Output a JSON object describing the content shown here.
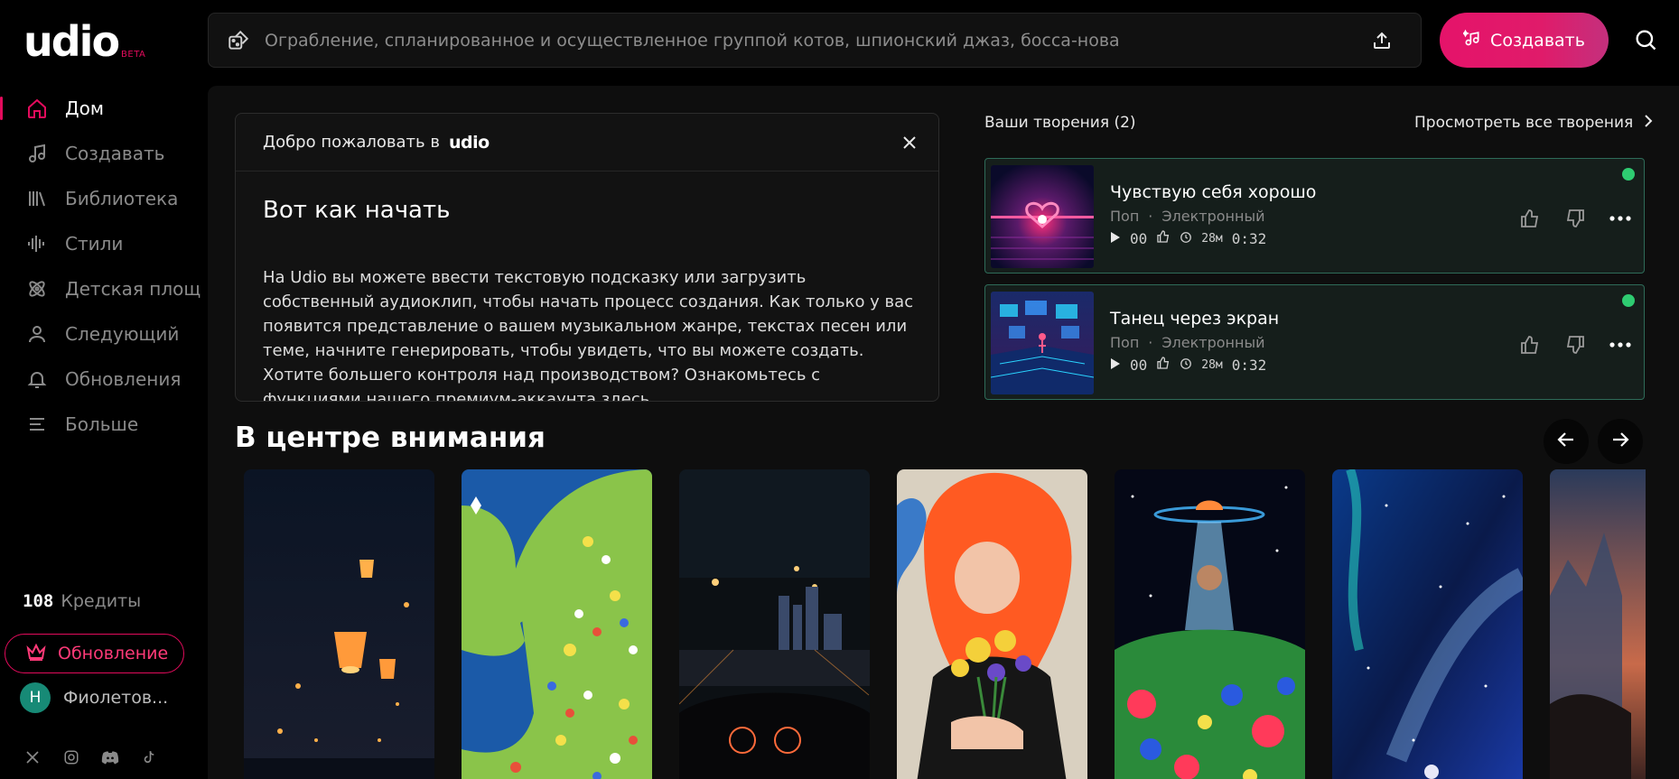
{
  "brand": {
    "logo": "udio",
    "beta": "BETA"
  },
  "nav": {
    "items": [
      {
        "label": "Дом",
        "icon": "home-icon",
        "active": true
      },
      {
        "label": "Создавать",
        "icon": "music-note-icon"
      },
      {
        "label": "Библиотека",
        "icon": "library-icon"
      },
      {
        "label": "Стили",
        "icon": "waveform-icon"
      },
      {
        "label": "Детская площ",
        "icon": "atom-icon"
      },
      {
        "label": "Следующий",
        "icon": "user-icon"
      },
      {
        "label": "Обновления",
        "icon": "bell-icon"
      },
      {
        "label": "Больше",
        "icon": "menu-icon"
      }
    ]
  },
  "credits": {
    "count": "108",
    "label": "Кредиты"
  },
  "upgrade": {
    "label": "Обновление"
  },
  "user": {
    "initial": "Н",
    "name": "Фиолетов..."
  },
  "search": {
    "placeholder": "Ограбление, спланированное и осуществленное группой котов, шпионский джаз, босса-нова"
  },
  "create_button": {
    "label": "Создавать"
  },
  "welcome": {
    "heading_prefix": "Добро пожаловать в",
    "brand": "udio",
    "title": "Вот как начать",
    "body": "На Udio вы можете ввести текстовую подсказку или загрузить собственный аудиоклип, чтобы начать процесс создания. Как только у вас появится представление о вашем музыкальном жанре, текстах песен или теме, начните генерировать, чтобы увидеть, что вы можете создать. Хотите большего контроля над производством? Ознакомьтесь с функциями нашего премиум-аккаунта",
    "link": "здесь",
    "period": "."
  },
  "creations": {
    "title": "Ваши творения (2)",
    "view_all": "Просмотреть все творения",
    "tracks": [
      {
        "title": "Чувствую себя хорошо",
        "genre": "Поп",
        "sep": "·",
        "style": "Электронный",
        "plays": "00",
        "age": "28м",
        "duration": "0:32"
      },
      {
        "title": "Танец через экран",
        "genre": "Поп",
        "sep": "·",
        "style": "Электронный",
        "plays": "00",
        "age": "28м",
        "duration": "0:32"
      }
    ]
  },
  "spotlight": {
    "title": "В центре внимания"
  },
  "colors": {
    "accent": "#e30b5c",
    "panel": "#0e0e0e",
    "track_bg": "#151e1b",
    "track_border": "#2e6b58",
    "live_dot": "#2ecc71"
  }
}
